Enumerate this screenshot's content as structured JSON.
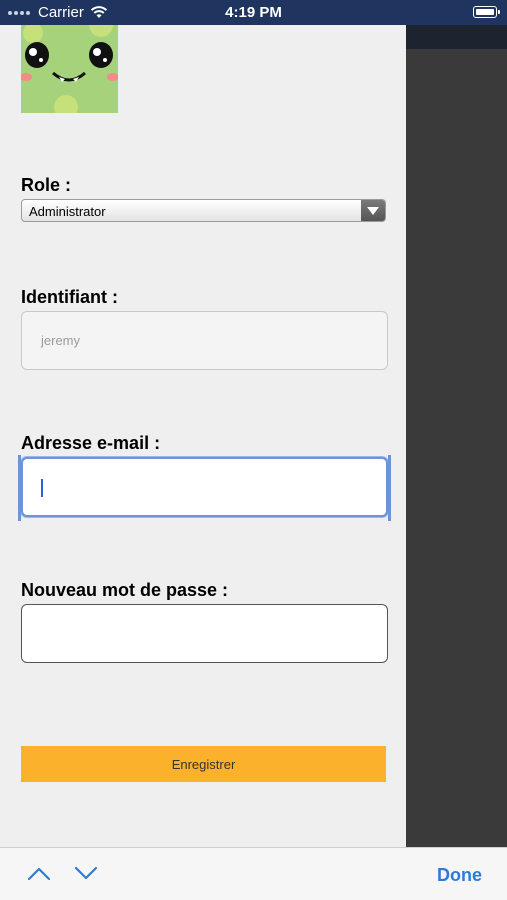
{
  "status_bar": {
    "carrier": "Carrier",
    "time": "4:19 PM",
    "wifi_icon": "wifi-icon",
    "battery_icon": "battery-icon"
  },
  "profile": {
    "avatar_icon": "monster-avatar-icon",
    "avatar_color": "#a5d27a"
  },
  "form": {
    "role": {
      "label": "Role :",
      "selected": "Administrator"
    },
    "identifiant": {
      "label": "Identifiant :",
      "placeholder": "jeremy"
    },
    "email": {
      "label": "Adresse e-mail :",
      "value": ""
    },
    "password": {
      "label": "Nouveau mot de passe :",
      "value": ""
    },
    "save_label": "Enregistrer",
    "save_color": "#fbb12b"
  },
  "keyboard_accessory": {
    "prev_icon": "chevron-up-icon",
    "next_icon": "chevron-down-icon",
    "done_label": "Done",
    "done_color": "#2f7ad8"
  }
}
